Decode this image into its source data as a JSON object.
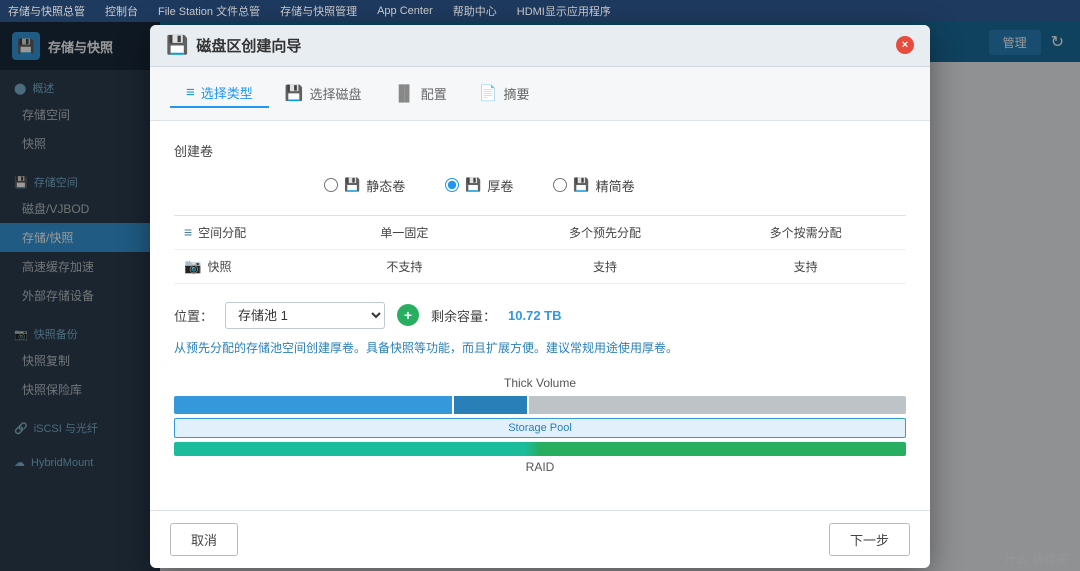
{
  "taskbar": {
    "items": [
      "存储与快照总管",
      "控制台",
      "File Station 文件总管",
      "存储与快照管理",
      "App Center",
      "帮助中心",
      "HDMI显示应用程序"
    ]
  },
  "sidebar": {
    "header_title": "存储与快照",
    "sections": [
      {
        "title": "概述",
        "icon": "🔵",
        "items": [
          "存储空间",
          "快照"
        ]
      },
      {
        "title": "存储空间",
        "icon": "💾",
        "items": [
          "磁盘/VJBOD",
          "存储/快照",
          "高速缓存加速",
          "外部存储设备"
        ]
      },
      {
        "title": "快照备份",
        "icon": "📷",
        "items": [
          "快照复制",
          "快照保险库"
        ]
      },
      {
        "title": "iSCSI 与光纤",
        "icon": "🔗",
        "items": []
      },
      {
        "title": "HybridMount",
        "icon": "☁",
        "items": []
      }
    ]
  },
  "topbar": {
    "manage_btn": "管理",
    "refresh_icon": "↻"
  },
  "dialog": {
    "title": "磁盘区创建向导",
    "title_icon": "💾",
    "close_btn": "×",
    "steps": [
      {
        "label": "选择类型",
        "icon": "≡",
        "active": true
      },
      {
        "label": "选择磁盘",
        "icon": "💾",
        "active": false
      },
      {
        "label": "配置",
        "icon": "▐▌",
        "active": false
      },
      {
        "label": "摘要",
        "icon": "📄",
        "active": false
      }
    ],
    "body": {
      "section_title": "创建卷",
      "volume_types": [
        {
          "label": "静态卷",
          "icon": "💾",
          "selected": false
        },
        {
          "label": "厚卷",
          "icon": "💾",
          "selected": true
        },
        {
          "label": "精简卷",
          "icon": "💾",
          "selected": false
        }
      ],
      "properties": {
        "headers": [
          "",
          "单一固定",
          "多个预先分配",
          "多个按需分配"
        ],
        "rows": [
          {
            "label": "空间分配",
            "icon": "≡",
            "values": [
              "单一固定",
              "多个预先分配",
              "多个按需分配"
            ]
          },
          {
            "label": "快照",
            "icon": "📷",
            "values": [
              "不支持",
              "支持",
              "支持"
            ]
          }
        ]
      },
      "location_label": "位置：",
      "location_value": "存储池 1",
      "remaining_label": "剩余容量：",
      "remaining_value": "10.72 TB",
      "info_text": "从预先分配的存储池空间创建厚卷。具备快照等功能，而且扩展方便。建议常规用途使用厚卷。",
      "viz": {
        "volume_label": "Thick Volume",
        "storage_pool_label": "Storage Pool",
        "raid_label": "RAID"
      }
    },
    "footer": {
      "cancel_btn": "取消",
      "next_btn": "下一步"
    }
  },
  "watermark": {
    "text": "值得买",
    "prefix": "什么"
  }
}
